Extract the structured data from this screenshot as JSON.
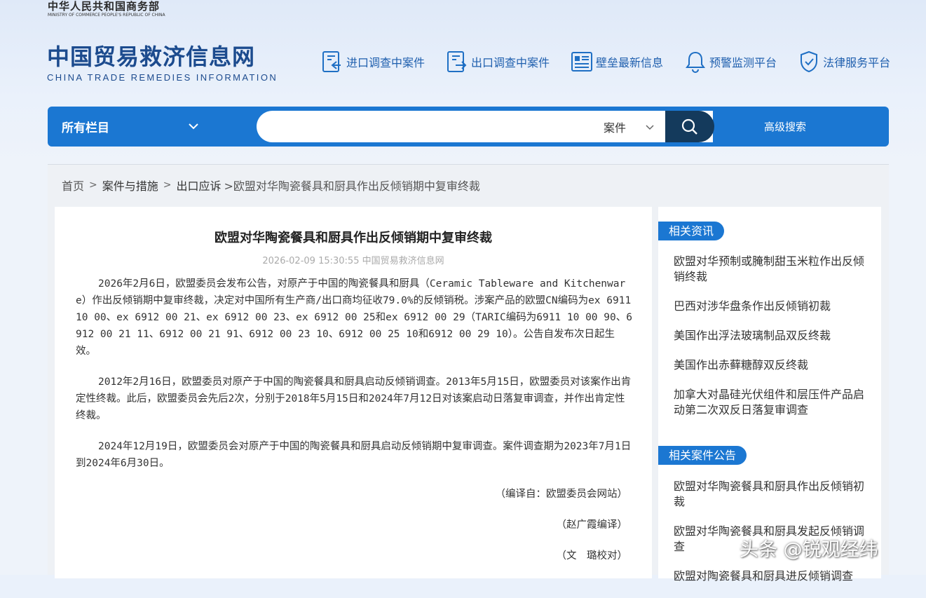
{
  "header": {
    "ministry_cn": "中华人民共和国商务部",
    "ministry_en": "MINISTRY OF COMMERCE PEOPLE'S REPUBLIC OF CHINA",
    "logo_cn": "中国贸易救济信息网",
    "logo_en": "CHINA TRADE REMEDIES INFORMATION",
    "nav": [
      {
        "label": "进口调查中案件",
        "icon": "import-doc-icon"
      },
      {
        "label": "出口调查中案件",
        "icon": "export-doc-icon"
      },
      {
        "label": "壁垒最新信息",
        "icon": "news-list-icon"
      },
      {
        "label": "预警监测平台",
        "icon": "bell-icon"
      },
      {
        "label": "法律服务平台",
        "icon": "shield-icon"
      }
    ]
  },
  "search": {
    "column_label": "所有栏目",
    "query": "",
    "type_label": "案件",
    "advanced_label": "高级搜索"
  },
  "breadcrumb": {
    "home": "首页",
    "level1": "案件与措施",
    "level2": "出口应诉",
    "current": ">欧盟对华陶瓷餐具和厨具作出反倾销期中复审终裁"
  },
  "article": {
    "title": "欧盟对华陶瓷餐具和厨具作出反倾销期中复审终裁",
    "meta": "2026-02-09 15:30:55 中国贸易救济信息网",
    "paragraphs": [
      "2026年2月6日，欧盟委员会发布公告，对原产于中国的陶瓷餐具和厨具（Ceramic Tableware and Kitchenware）作出反倾销期中复审终裁，决定对中国所有生产商/出口商均征收79.0%的反倾销税。涉案产品的欧盟CN编码为ex 6911 10 00、ex 6912 00 21、ex 6912 00 23、ex 6912 00 25和ex 6912 00 29（TARIC编码为6911 10 00 90、6912 00 21 11、6912 00 21 91、6912 00 23 10、6912 00 25 10和6912 00 29 10）。公告自发布次日起生效。",
      "2012年2月16日，欧盟委员对原产于中国的陶瓷餐具和厨具启动反倾销调查。2013年5月15日，欧盟委员对该案作出肯定性终裁。此后，欧盟委员会先后2次，分别于2018年5月15日和2024年7月12日对该案启动日落复审调查，并作出肯定性终裁。",
      "2024年12月19日，欧盟委员会对原产于中国的陶瓷餐具和厨具启动反倾销期中复审调查。案件调查期为2023年7月1日到2024年6月30日。"
    ],
    "source": "（编译自：欧盟委员会网站）",
    "translator": "（赵广霞编译）",
    "proofreader": "（文　璐校对）"
  },
  "sidebar": {
    "related_news_heading": "相关资讯",
    "related_news": [
      "欧盟对华预制或腌制甜玉米粒作出反倾销终裁",
      "巴西对涉华盘条作出反倾销初裁",
      "美国作出浮法玻璃制品双反终裁",
      "美国作出赤藓糖醇双反终裁",
      "加拿大对晶硅光伏组件和层压件产品启动第二次双反日落复审调查"
    ],
    "related_cases_heading": "相关案件公告",
    "related_cases": [
      "欧盟对华陶瓷餐具和厨具作出反倾销初裁",
      "欧盟对华陶瓷餐具和厨具发起反倾销调查",
      "欧盟对陶瓷餐具和厨具进反倾销调查"
    ]
  },
  "watermark": "头条 @锐观经纬",
  "colors": {
    "brand_blue": "#1b77d2",
    "logo_blue": "#1c4b8e",
    "search_button": "#143a5c"
  }
}
